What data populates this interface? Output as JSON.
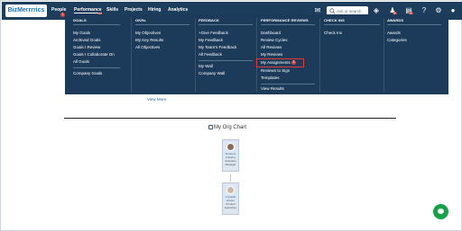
{
  "app": {
    "logo_text": "BizMerrrrics"
  },
  "nav": {
    "items": [
      {
        "label": "People",
        "badge": "1"
      },
      {
        "label": "Performance",
        "badge": "2"
      },
      {
        "label": "Skills"
      },
      {
        "label": "Projects"
      },
      {
        "label": "Hiring"
      },
      {
        "label": "Analytics"
      }
    ],
    "search_placeholder": "Ask or search",
    "notification_badges": [
      "5",
      "3"
    ]
  },
  "menu": {
    "goals": {
      "heading": "GOALS",
      "items": [
        "My Goals",
        "Archived Goals",
        "Goals I Review",
        "Goals I Collaborate On",
        "All Goals",
        "Company Goals"
      ]
    },
    "okrs": {
      "heading": "OKRs",
      "items": [
        "My Objectives",
        "My Key Results",
        "All Objectives"
      ]
    },
    "feedback": {
      "heading": "FEEDBACK",
      "items": [
        "+Give Feedback",
        "My Feedback",
        "My Team's Feedback",
        "All Feedback",
        "My Wall",
        "Company Wall"
      ]
    },
    "performance_reviews": {
      "heading": "PERFORMANCE REVIEWS",
      "items": [
        "Dashboard",
        "Review Cycles",
        "All Reviews",
        "My Reviews",
        "My Assignments",
        "Reviews to Sign",
        "Templates",
        "View Results"
      ],
      "assignments_badge": "3"
    },
    "checkins": {
      "heading": "CHECK INS",
      "items": [
        "Check Ins"
      ]
    },
    "awards": {
      "heading": "AWARDS",
      "items": [
        "Awards",
        "Categories"
      ]
    }
  },
  "page": {
    "view_more": "View More",
    "org_chart_title": "My Org Chart",
    "cards": [
      {
        "name": "Florence Fielding",
        "role": "Assistant Manager"
      },
      {
        "name": "Crystelle Harper",
        "role": "Product Executive"
      }
    ]
  },
  "colors": {
    "nav_bg": "#1d3d5c",
    "menu_bg": "#1c3b5a",
    "highlight": "#e53935",
    "chat": "#17a24a"
  }
}
